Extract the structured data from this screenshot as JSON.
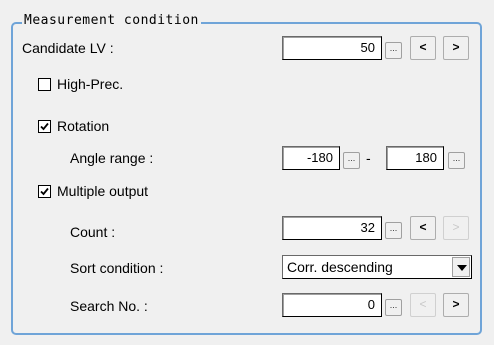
{
  "group": {
    "title": "Measurement condition"
  },
  "candidate_lv": {
    "label": "Candidate LV :",
    "value": "50",
    "dots": "...",
    "prev": "<",
    "next": ">"
  },
  "high_prec": {
    "label": "High-Prec.",
    "checked": false
  },
  "rotation": {
    "label": "Rotation",
    "checked": true,
    "angle_label": "Angle range :",
    "angle_min": "-180",
    "angle_max": "180",
    "separator": "-",
    "dots": "..."
  },
  "multiple_output": {
    "label": "Multiple output",
    "checked": true,
    "count_label": "Count :",
    "count_value": "32",
    "dots": "...",
    "prev": "<",
    "next": ">",
    "sort_label": "Sort condition :",
    "sort_value": "Corr. descending",
    "search_label": "Search No. :",
    "search_value": "0"
  }
}
